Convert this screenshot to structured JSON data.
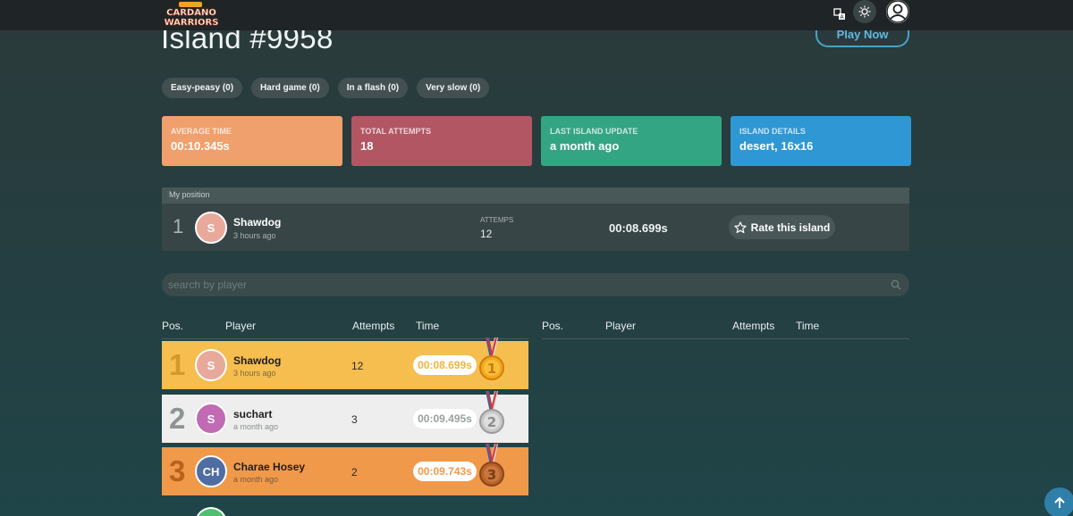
{
  "header": {
    "logo_text_line1": "CARDANO",
    "logo_text_line2": "WARRIORS",
    "translate_icon": "translate-icon",
    "theme_icon": "sun-icon",
    "profile_icon": "user-icon"
  },
  "page": {
    "title": "Island #9958",
    "play_now_label": "Play Now"
  },
  "tags": [
    {
      "label": "Easy-peasy (0)"
    },
    {
      "label": "Hard game (0)"
    },
    {
      "label": "In a flash (0)"
    },
    {
      "label": "Very slow (0)"
    }
  ],
  "stats": [
    {
      "label": "AVERAGE TIME",
      "value": "00:10.345s",
      "color": "#f0a06d"
    },
    {
      "label": "TOTAL ATTEMPTS",
      "value": "18",
      "color": "#b25663"
    },
    {
      "label": "LAST ISLAND UPDATE",
      "value": "a month ago",
      "color": "#33a582"
    },
    {
      "label": "ISLAND DETAILS",
      "value": "desert, 16x16",
      "color": "#2f97d4"
    }
  ],
  "my_position": {
    "header": "My position",
    "rank": "1",
    "avatar_initials": "S",
    "avatar_color": "#e8a99b",
    "name": "Shawdog",
    "time_ago": "3 hours ago",
    "attempts_label": "ATTEMPS",
    "attempts": "12",
    "time": "00:08.699s",
    "rate_label": "Rate this island"
  },
  "search": {
    "placeholder": "search by player"
  },
  "table_headers": {
    "pos": "Pos.",
    "player": "Player",
    "attempts": "Attempts",
    "time": "Time"
  },
  "leaderboard": [
    {
      "rank": "1",
      "initials": "S",
      "avatar_color": "#e8a99b",
      "name": "Shawdog",
      "time_ago": "3 hours ago",
      "attempts": "12",
      "time": "00:08.699s",
      "row_color": "#f6be4f",
      "rank_color": "#d39a2a",
      "time_color": "#f2b33d",
      "medal_number": "1",
      "medal_color": "#f4a81c"
    },
    {
      "rank": "2",
      "initials": "S",
      "avatar_color": "#c06bb3",
      "name": "suchart",
      "time_ago": "a month ago",
      "attempts": "3",
      "time": "00:09.495s",
      "row_color": "#eeeeee",
      "rank_color": "#8e9393",
      "time_color": "#9aa0a0",
      "medal_number": "2",
      "medal_color": "#c8c8c8"
    },
    {
      "rank": "3",
      "initials": "CH",
      "avatar_color": "#4e6da3",
      "name": "Charae Hosey",
      "time_ago": "a month ago",
      "attempts": "2",
      "time": "00:09.743s",
      "row_color": "#f0994a",
      "rank_color": "#b8621c",
      "time_color": "#f0994a",
      "medal_number": "3",
      "medal_color": "#b8622a"
    }
  ],
  "scroll_top_icon": "arrow-up-icon"
}
